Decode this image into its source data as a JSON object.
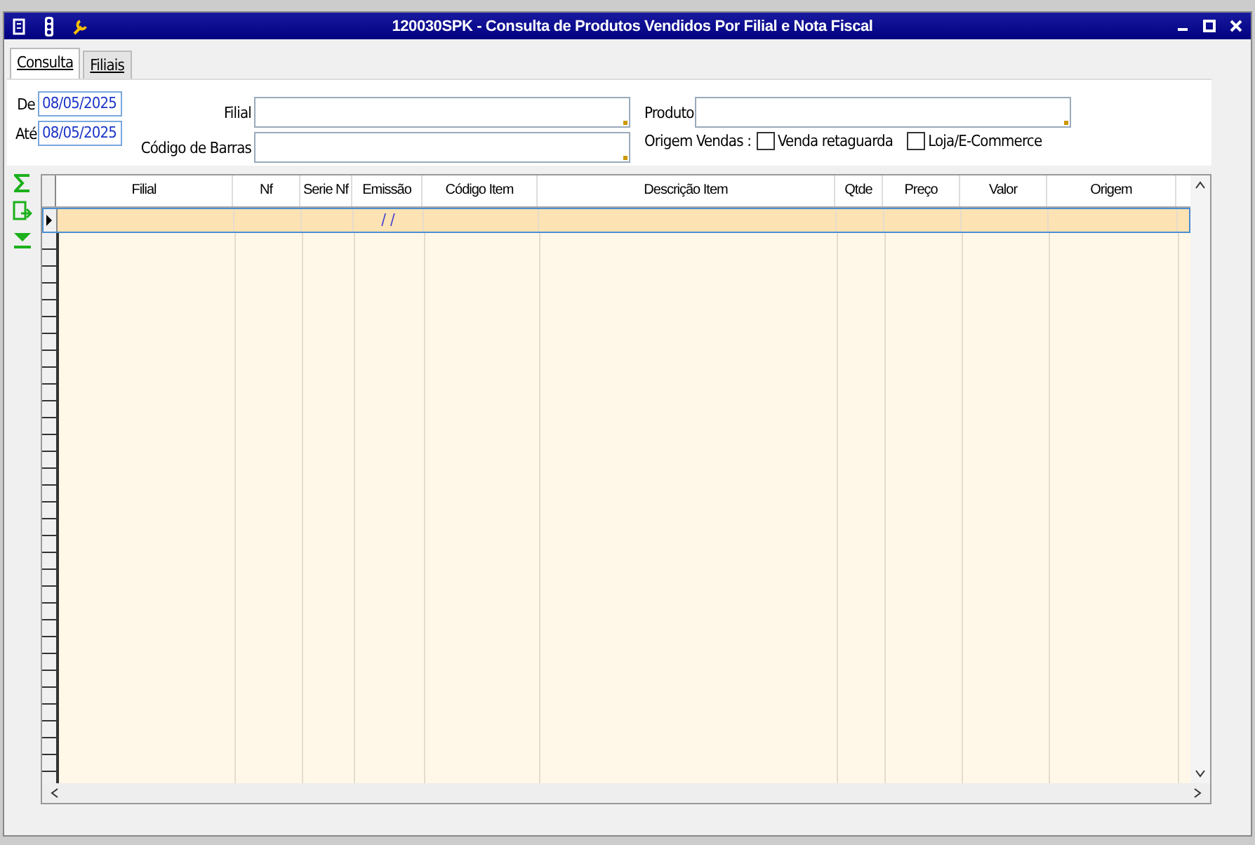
{
  "window": {
    "title": "120030SPK - Consulta de Produtos Vendidos Por Filial e Nota Fiscal"
  },
  "tabs": [
    {
      "label": "Consulta",
      "selected": true
    },
    {
      "label": "Filiais",
      "selected": false
    }
  ],
  "dates": [
    {
      "label": "De",
      "value": "08/05/2025"
    },
    {
      "label": "Até",
      "value": "08/05/2025"
    }
  ],
  "lookups": [
    {
      "label": "Filial"
    },
    {
      "label": "Código de Barras"
    }
  ],
  "produto": {
    "label": "Produto"
  },
  "origem": {
    "label": "Origem Vendas :",
    "options": [
      {
        "label": "Venda retaguarda",
        "checked": false
      },
      {
        "label": "Loja/E-Commerce",
        "checked": false
      }
    ]
  },
  "grid": {
    "columns": [
      "Filial",
      "Nf",
      "Serie Nf",
      "Emissão",
      "Código Item",
      "Descrição Item",
      "Qtde",
      "Preço",
      "Valor",
      "Origem"
    ],
    "rows": [
      {
        "selected": true,
        "cells": [
          "",
          "",
          "",
          "/ /",
          "",
          "",
          "",
          "",
          "",
          ""
        ]
      }
    ]
  }
}
